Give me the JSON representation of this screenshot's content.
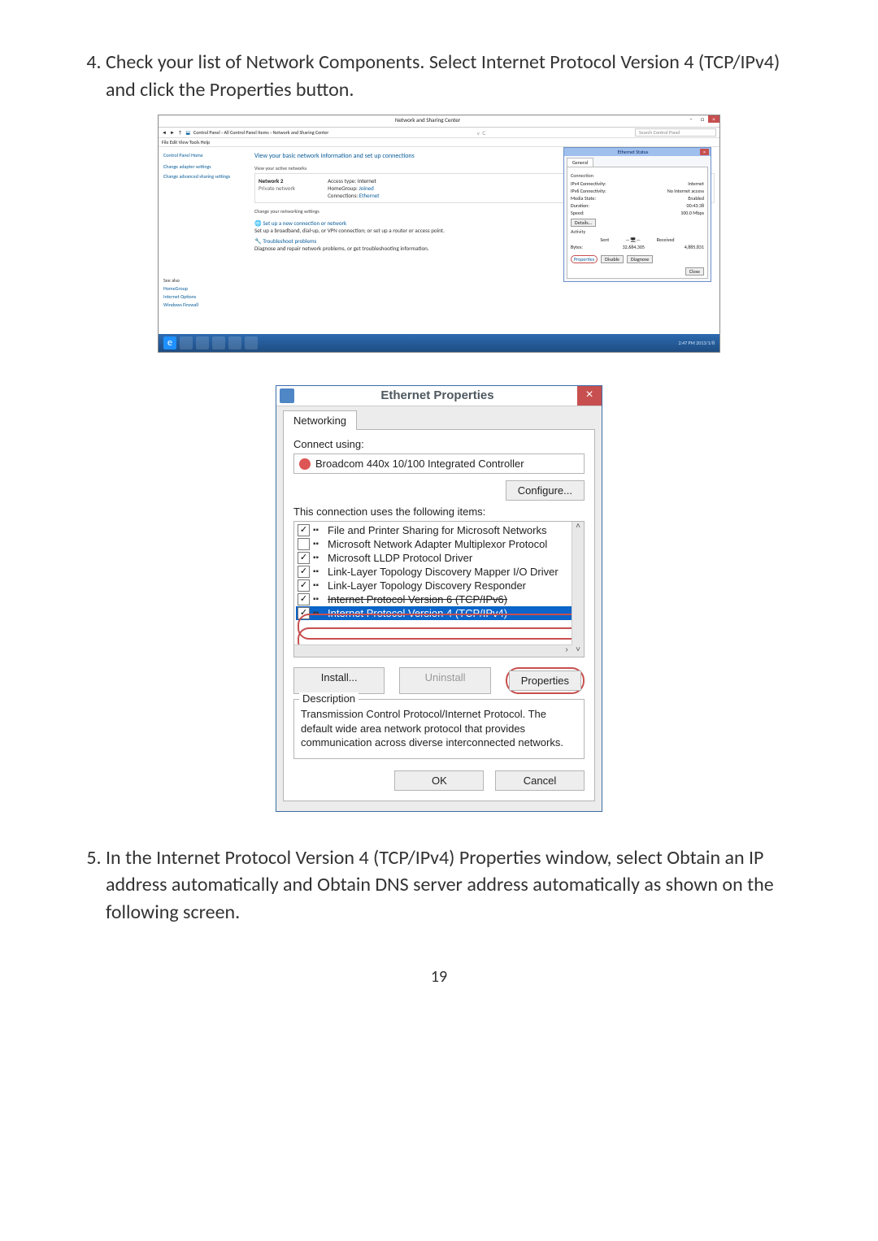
{
  "page_number": "19",
  "steps": {
    "4": "Check your list of Network Components. Select Internet Protocol Version 4 (TCP/IPv4) and click the Properties button.",
    "5": "In the Internet Protocol Version 4 (TCP/IPv4) Properties window, select Obtain an IP address automatically and Obtain DNS server address automatically as shown on the following screen."
  },
  "fig1": {
    "window_title": "Network and Sharing Center",
    "breadcrumb": "Control Panel  ›  All Control Panel Items  ›  Network and Sharing Center",
    "search_placeholder": "Search Control Panel",
    "menubar": "File   Edit   View   Tools   Help",
    "side": {
      "home": "Control Panel Home",
      "links": [
        "Change adapter settings",
        "Change advanced sharing settings"
      ],
      "see_also_title": "See also",
      "see_also": [
        "HomeGroup",
        "Internet Options",
        "Windows Firewall"
      ]
    },
    "main": {
      "heading": "View your basic network information and set up connections",
      "active_label": "View your active networks",
      "network_name": "Network 2",
      "network_type": "Private network",
      "access_type_label": "Access type:",
      "access_type_value": "Internet",
      "homegroup_label": "HomeGroup:",
      "homegroup_value": "Joined",
      "connections_label": "Connections:",
      "connections_value": "Ethernet",
      "change_label": "Change your networking settings",
      "setup_title": "Set up a new connection or network",
      "setup_desc": "Set up a broadband, dial-up, or VPN connection; or set up a router or access point.",
      "trouble_title": "Troubleshoot problems",
      "trouble_desc": "Diagnose and repair network problems, or get troubleshooting information."
    },
    "status": {
      "title": "Ethernet Status",
      "tab": "General",
      "conn_title": "Connection",
      "rows": [
        [
          "IPv4 Connectivity:",
          "Internet"
        ],
        [
          "IPv6 Connectivity:",
          "No Internet access"
        ],
        [
          "Media State:",
          "Enabled"
        ],
        [
          "Duration:",
          "00:43:38"
        ],
        [
          "Speed:",
          "100.0 Mbps"
        ]
      ],
      "details_btn": "Details...",
      "activity_title": "Activity",
      "sent_label": "Sent",
      "recv_label": "Received",
      "bytes_label": "Bytes:",
      "bytes_sent": "32,684,305",
      "bytes_recv": "4,885,831",
      "properties_btn": "Properties",
      "disable_btn": "Disable",
      "diagnose_btn": "Diagnose",
      "close_btn": "Close"
    },
    "tray_time": "2:47 PM\n2013/1/8"
  },
  "fig2": {
    "title": "Ethernet Properties",
    "tab": "Networking",
    "connect_label": "Connect using:",
    "adapter": "Broadcom 440x 10/100 Integrated Controller",
    "configure_btn": "Configure...",
    "items_label": "This connection uses the following items:",
    "items": [
      {
        "checked": true,
        "text": "File and Printer Sharing for Microsoft Networks"
      },
      {
        "checked": false,
        "text": "Microsoft Network Adapter Multiplexor Protocol"
      },
      {
        "checked": true,
        "text": "Microsoft LLDP Protocol Driver"
      },
      {
        "checked": true,
        "text": "Link-Layer Topology Discovery Mapper I/O Driver"
      },
      {
        "checked": true,
        "text": "Link-Layer Topology Discovery Responder"
      },
      {
        "checked": true,
        "text": "Internet Protocol Version 6 (TCP/IPv6)",
        "strike": true
      },
      {
        "checked": true,
        "text": "Internet Protocol Version 4 (TCP/IPv4)",
        "selected": true
      }
    ],
    "install_btn": "Install...",
    "uninstall_btn": "Uninstall",
    "properties_btn": "Properties",
    "desc_title": "Description",
    "desc_text": "Transmission Control Protocol/Internet Protocol. The default wide area network protocol that provides communication across diverse interconnected networks.",
    "ok_btn": "OK",
    "cancel_btn": "Cancel"
  }
}
